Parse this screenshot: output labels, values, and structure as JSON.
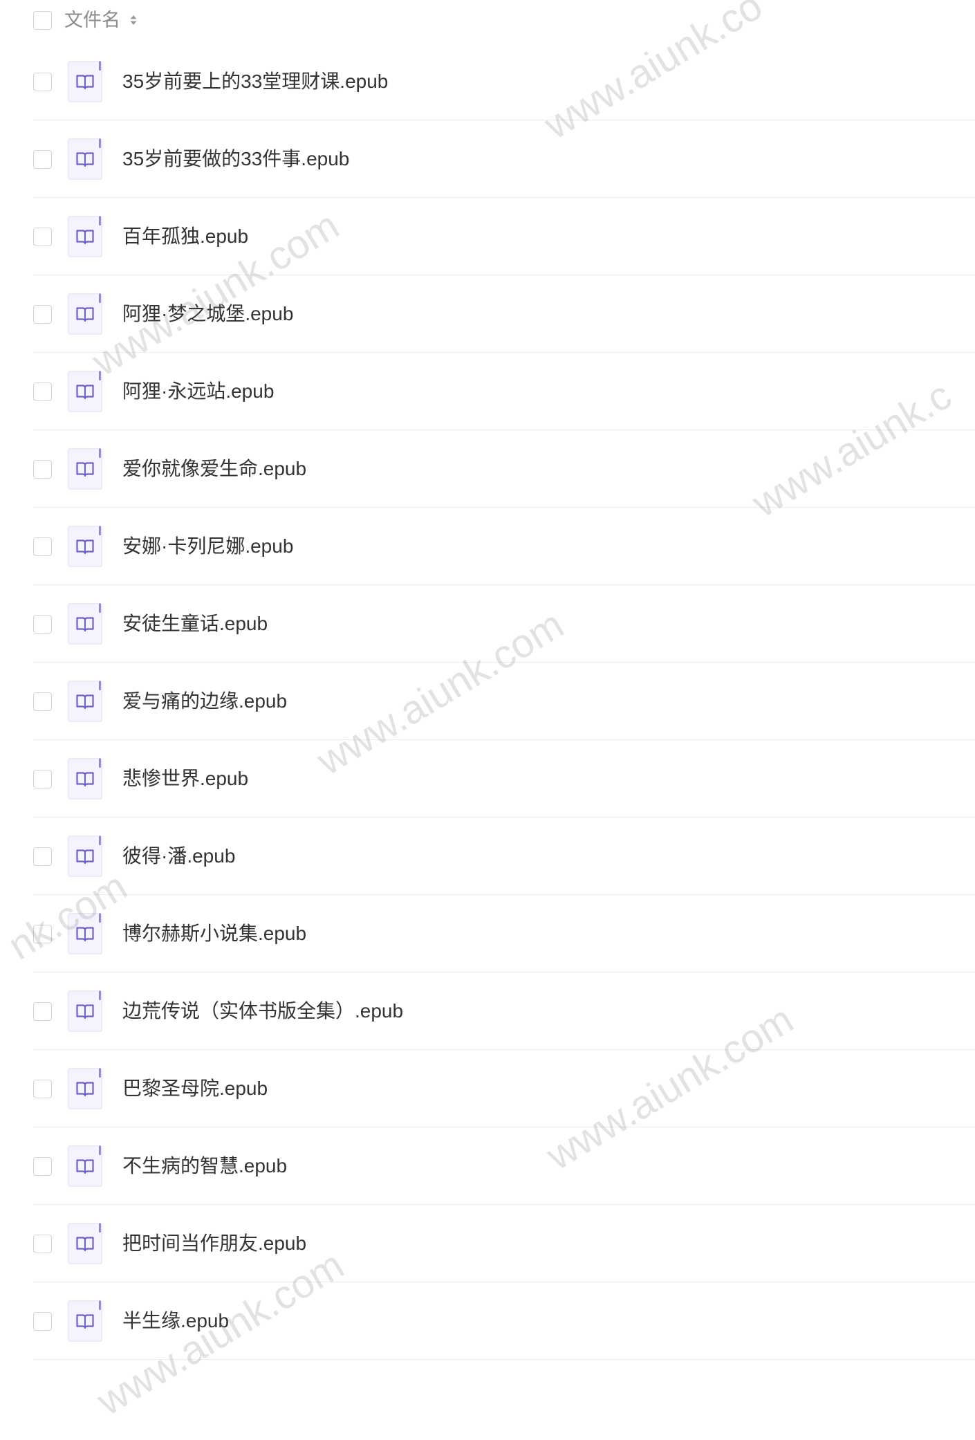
{
  "header": {
    "column_label": "文件名",
    "sort_icon": "sort-icon"
  },
  "file_icon": "epub-book-icon",
  "colors": {
    "text": "#333333",
    "header_text": "#8a8a8a",
    "icon_accent": "#6a5fcf",
    "icon_background": "#f5f3fd",
    "divider": "#ececec",
    "checkbox_border": "#d3d3d3"
  },
  "files": [
    {
      "name": "35岁前要上的33堂理财课.epub"
    },
    {
      "name": "35岁前要做的33件事.epub"
    },
    {
      "name": "百年孤独.epub"
    },
    {
      "name": "阿狸·梦之城堡.epub"
    },
    {
      "name": "阿狸·永远站.epub"
    },
    {
      "name": "爱你就像爱生命.epub"
    },
    {
      "name": "安娜·卡列尼娜.epub"
    },
    {
      "name": "安徒生童话.epub"
    },
    {
      "name": "爱与痛的边缘.epub"
    },
    {
      "name": "悲惨世界.epub"
    },
    {
      "name": "彼得·潘.epub"
    },
    {
      "name": "博尔赫斯小说集.epub"
    },
    {
      "name": "边荒传说（实体书版全集）.epub"
    },
    {
      "name": "巴黎圣母院.epub"
    },
    {
      "name": "不生病的智慧.epub"
    },
    {
      "name": "把时间当作朋友.epub"
    },
    {
      "name": "半生缘.epub"
    }
  ],
  "watermarks": [
    "www.aiunk.co",
    "www.aiunk.com",
    "www.aiunk.c",
    "www.aiunk.com",
    "nk.com",
    "www.aiunk.com",
    "www.aiunk.com"
  ]
}
